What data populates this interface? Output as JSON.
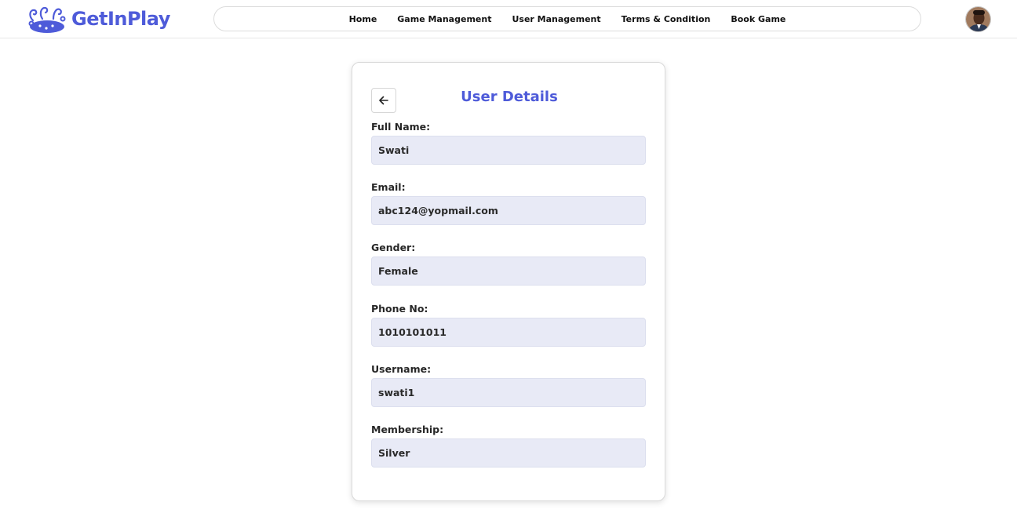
{
  "brand": {
    "name": "GetInPlay",
    "logo_icon": "gamepad-logo-icon",
    "color": "#4e5bd9"
  },
  "nav": {
    "links": [
      "Home",
      "Game Management",
      "User Management",
      "Terms & Condition",
      "Book Game"
    ]
  },
  "user_avatar": {
    "icon": "user-avatar"
  },
  "card": {
    "title": "User Details",
    "back_icon": "arrow-left-icon",
    "fields": [
      {
        "label": "Full Name:",
        "value": "Swati"
      },
      {
        "label": "Email:",
        "value": "abc124@yopmail.com"
      },
      {
        "label": "Gender:",
        "value": "Female"
      },
      {
        "label": "Phone No:",
        "value": "1010101011"
      },
      {
        "label": "Username:",
        "value": "swati1"
      },
      {
        "label": "Membership:",
        "value": "Silver"
      }
    ]
  },
  "colors": {
    "accent": "#4e5bd9",
    "field_bg": "#e8eaf6"
  }
}
